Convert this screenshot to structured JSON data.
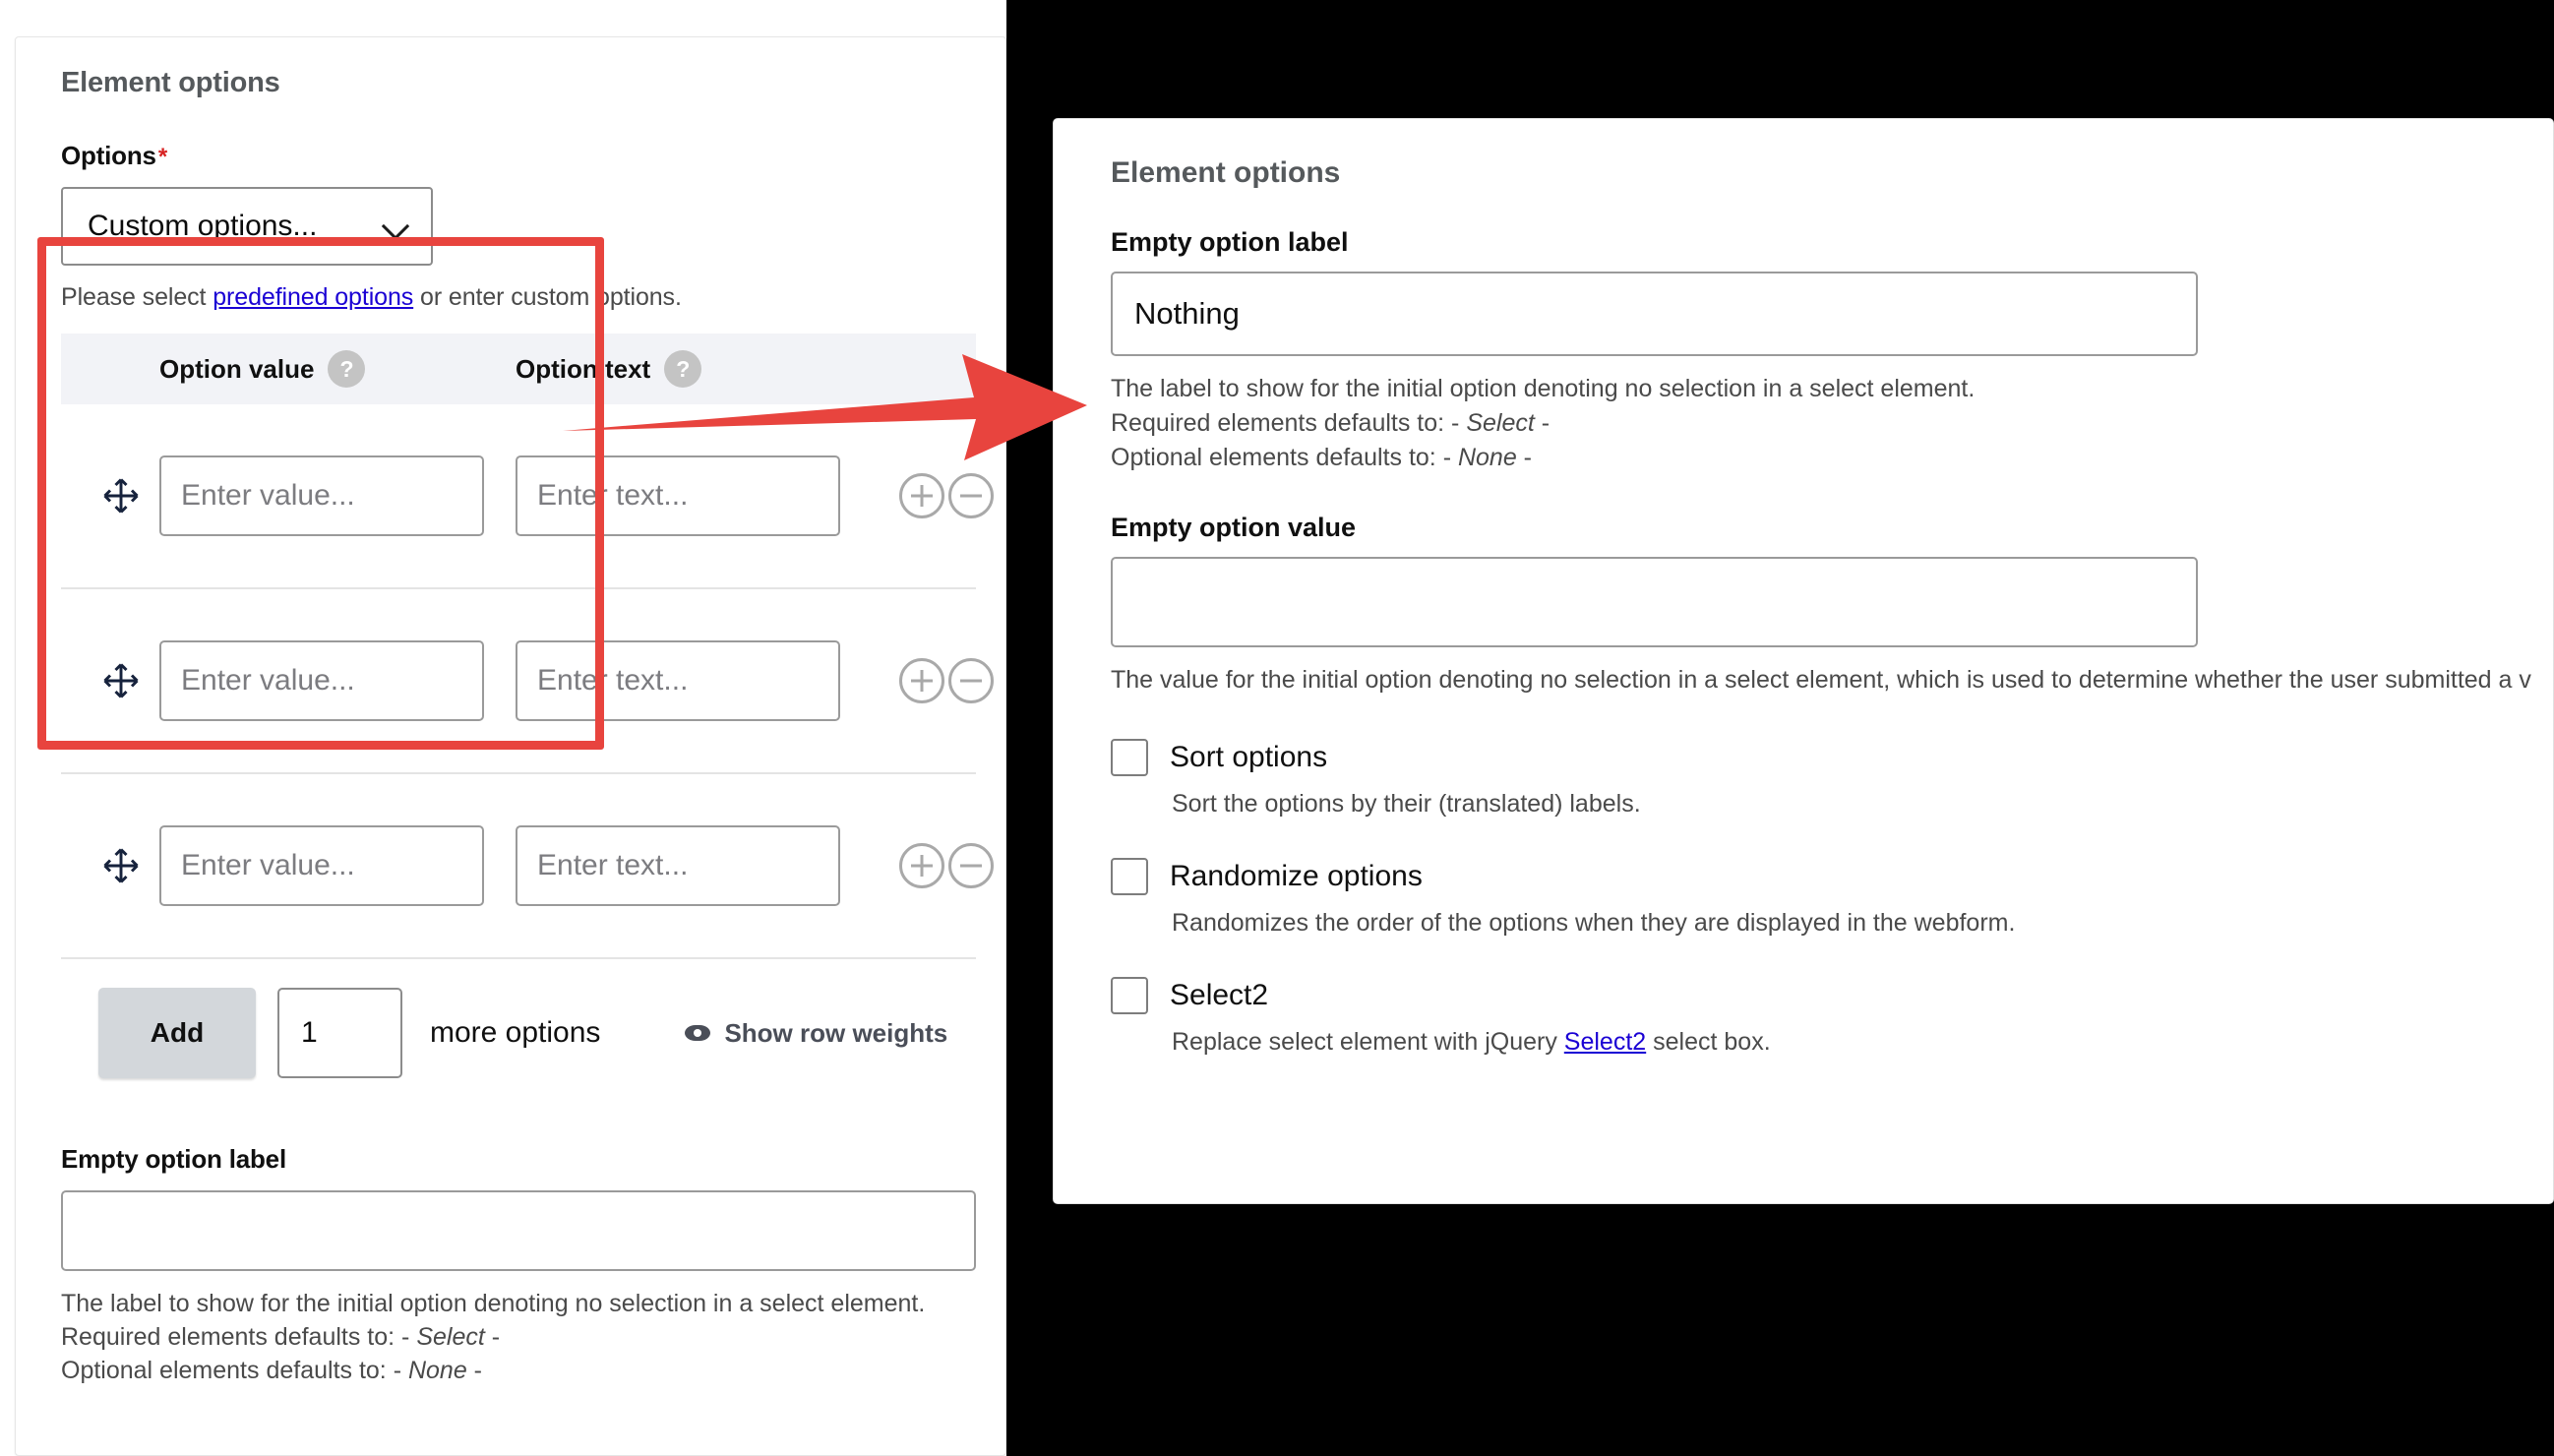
{
  "left_panel": {
    "section_title": "Element options",
    "options_field": {
      "label": "Options",
      "required_marker": "*",
      "selected_value": "Custom options...",
      "chevron_icon": "chevron-down-icon",
      "help_prefix": "Please select ",
      "help_link": "predefined options",
      "help_suffix": " or enter custom options."
    },
    "options_table": {
      "headers": {
        "handle": "",
        "option_value": "Option value",
        "option_value_help_icon": "question-mark-icon",
        "option_text": "Option text",
        "option_text_help_icon": "question-mark-icon",
        "operations": ""
      },
      "rows": [
        {
          "drag_icon": "move-handle-icon",
          "value_placeholder": "Enter value...",
          "text_placeholder": "Enter text...",
          "add_icon": "plus-circle-icon",
          "remove_icon": "minus-circle-icon"
        },
        {
          "drag_icon": "move-handle-icon",
          "value_placeholder": "Enter value...",
          "text_placeholder": "Enter text...",
          "add_icon": "plus-circle-icon",
          "remove_icon": "minus-circle-icon"
        },
        {
          "drag_icon": "move-handle-icon",
          "value_placeholder": "Enter value...",
          "text_placeholder": "Enter text...",
          "add_icon": "plus-circle-icon",
          "remove_icon": "minus-circle-icon"
        }
      ],
      "footer": {
        "add_label": "Add",
        "count_value": "1",
        "more_label": "more options",
        "show_weights_label": "Show row weights",
        "show_weights_icon": "eye-icon"
      }
    },
    "empty_option_label": {
      "label": "Empty option label",
      "value": "",
      "desc_line1": "The label to show for the initial option denoting no selection in a select element.",
      "desc_line2_prefix": "Required elements defaults to: - ",
      "desc_line2_em": "Select",
      "desc_line2_suffix": " -",
      "desc_line3_prefix": "Optional elements defaults to: - ",
      "desc_line3_em": "None",
      "desc_line3_suffix": " -"
    },
    "highlight_color": "#e8443e"
  },
  "arrow": {
    "name": "red-arrow-annotation",
    "color": "#e8443e"
  },
  "right_panel": {
    "section_title": "Element options",
    "empty_option_label": {
      "label": "Empty option label",
      "value": "Nothing",
      "desc_line1": "The label to show for the initial option denoting no selection in a select element.",
      "desc_line2_prefix": "Required elements defaults to: - ",
      "desc_line2_em": "Select",
      "desc_line2_suffix": " -",
      "desc_line3_prefix": "Optional elements defaults to: - ",
      "desc_line3_em": "None",
      "desc_line3_suffix": " -"
    },
    "empty_option_value": {
      "label": "Empty option value",
      "value": "",
      "desc": "The value for the initial option denoting no selection in a select element, which is used to determine whether the user submitted a v"
    },
    "checkboxes": [
      {
        "label": "Sort options",
        "checked": false,
        "desc": "Sort the options by their (translated) labels."
      },
      {
        "label": "Randomize options",
        "checked": false,
        "desc": "Randomizes the order of the options when they are displayed in the webform."
      },
      {
        "label": "Select2",
        "checked": false,
        "desc_prefix": "Replace select element with jQuery ",
        "desc_link": "Select2",
        "desc_suffix": " select box."
      }
    ]
  }
}
